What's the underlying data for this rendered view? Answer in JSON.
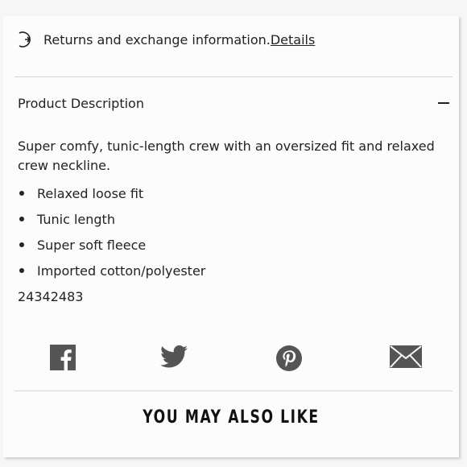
{
  "returns": {
    "text": "Returns and exchange information.",
    "link": "Details",
    "icon": "returns-arrow-icon"
  },
  "description": {
    "header": "Product Description",
    "collapse_icon": "minus-icon",
    "text": "Super comfy, tunic-length crew with an oversized fit and relaxed crew neckline.",
    "bullets": [
      "Relaxed loose fit",
      "Tunic length",
      "Super soft fleece",
      "Imported cotton/polyester"
    ],
    "sku": "24342483"
  },
  "share": {
    "icons": [
      "facebook-icon",
      "twitter-icon",
      "pinterest-icon",
      "email-icon"
    ],
    "color": "#555555"
  },
  "recommendations": {
    "title": "YOU MAY ALSO LIKE"
  }
}
